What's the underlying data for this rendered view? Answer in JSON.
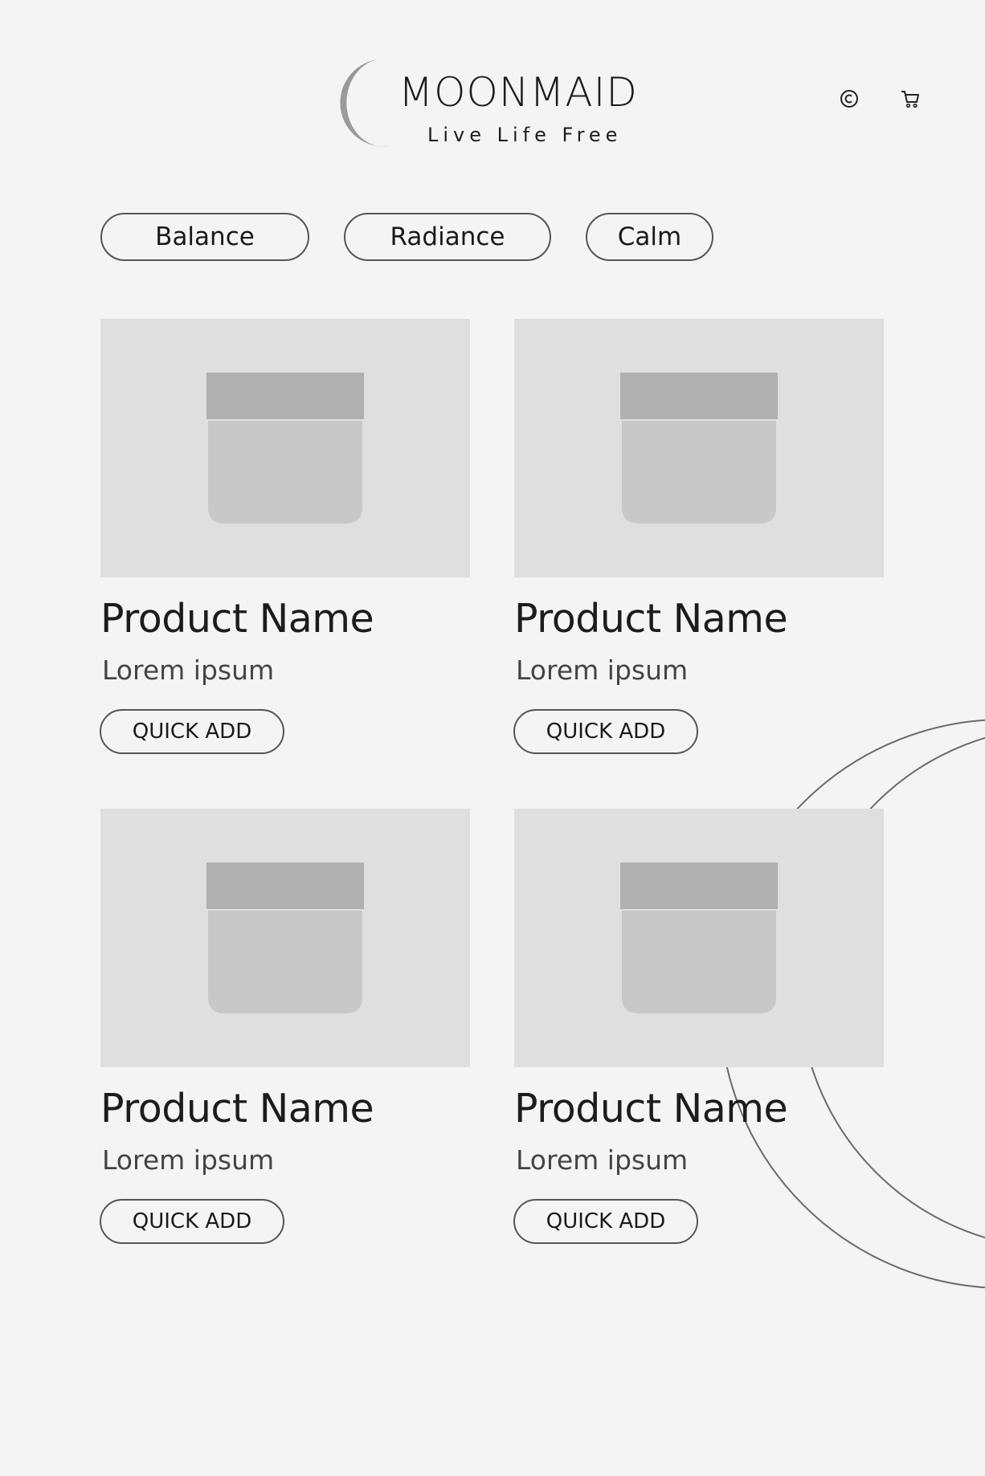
{
  "header": {
    "brand": "MOONMAID",
    "tagline": "Live Life Free",
    "icons": [
      "account-icon",
      "cart-icon"
    ]
  },
  "filters": [
    "Balance",
    "Radiance",
    "Calm"
  ],
  "products": [
    {
      "name": "Product Name",
      "description": "Lorem ipsum",
      "action": "QUICK ADD"
    },
    {
      "name": "Product Name",
      "description": "Lorem ipsum",
      "action": "QUICK ADD"
    },
    {
      "name": "Product Name",
      "description": "Lorem ipsum",
      "action": "QUICK ADD"
    },
    {
      "name": "Product Name",
      "description": "Lorem ipsum",
      "action": "QUICK ADD"
    }
  ],
  "colors": {
    "background": "#f4f4f4",
    "image_placeholder": "#dfdfdf",
    "jar_lid": "#b0b0b0",
    "jar_body": "#c8c8c8",
    "text": "#1c1c1c",
    "outline": "#555555"
  }
}
